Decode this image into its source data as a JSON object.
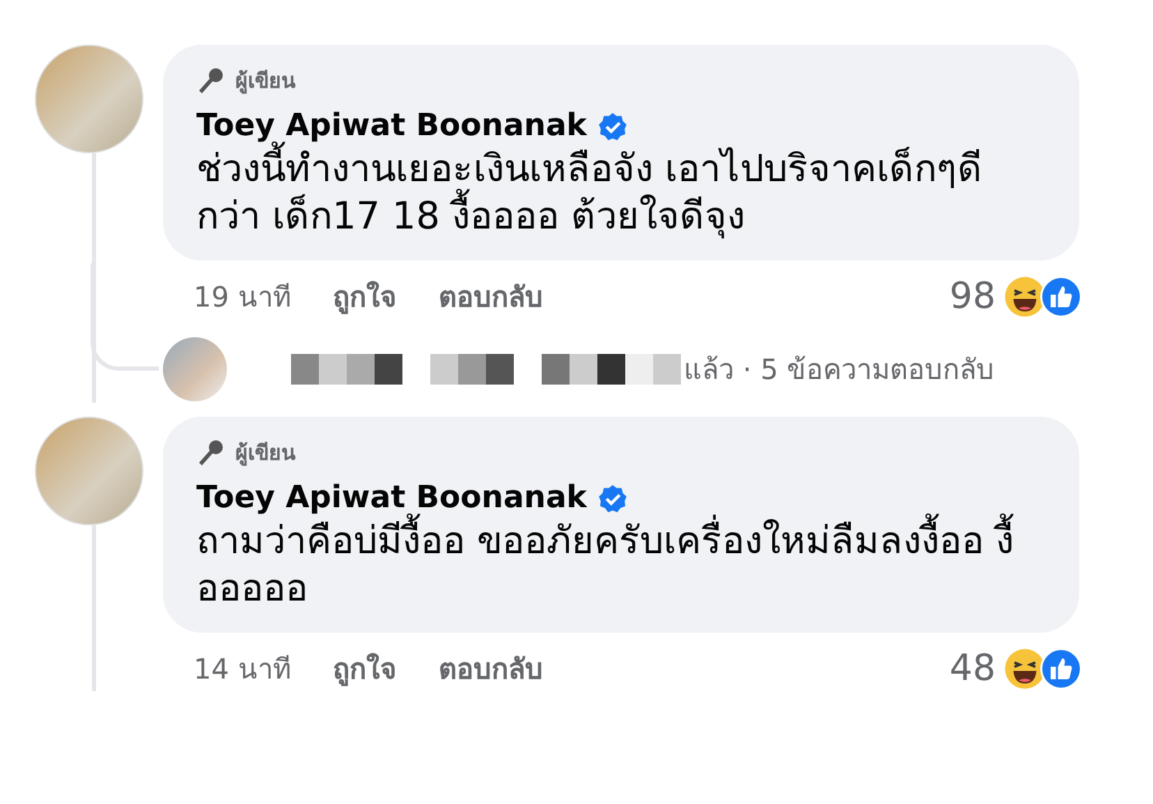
{
  "comments": [
    {
      "author_badge": "ผู้เขียน",
      "author": "Toey Apiwat Boonanak",
      "verified": true,
      "text": "ช่วงนี้ทำงานเยอะเงินเหลือจัง เอาไปบริจาคเด็กๆดีกว่า เด็ก17 18 งื้ออออ ต้วยใจดีจุง",
      "time": "19 นาที",
      "like": "ถูกใจ",
      "reply": "ตอบกลับ",
      "reaction_count": "98",
      "reply_summary": {
        "text": "แล้ว · 5 ข้อความตอบกลับ",
        "censored": true
      }
    },
    {
      "author_badge": "ผู้เขียน",
      "author": "Toey Apiwat Boonanak",
      "verified": true,
      "text": "ถามว่าคือบ่มีงื้ออ ขออภัยครับเครื่องใหม่ลืมลงงื้ออ งื้อออออ",
      "time": "14 นาที",
      "like": "ถูกใจ",
      "reply": "ตอบกลับ",
      "reaction_count": "48"
    }
  ]
}
